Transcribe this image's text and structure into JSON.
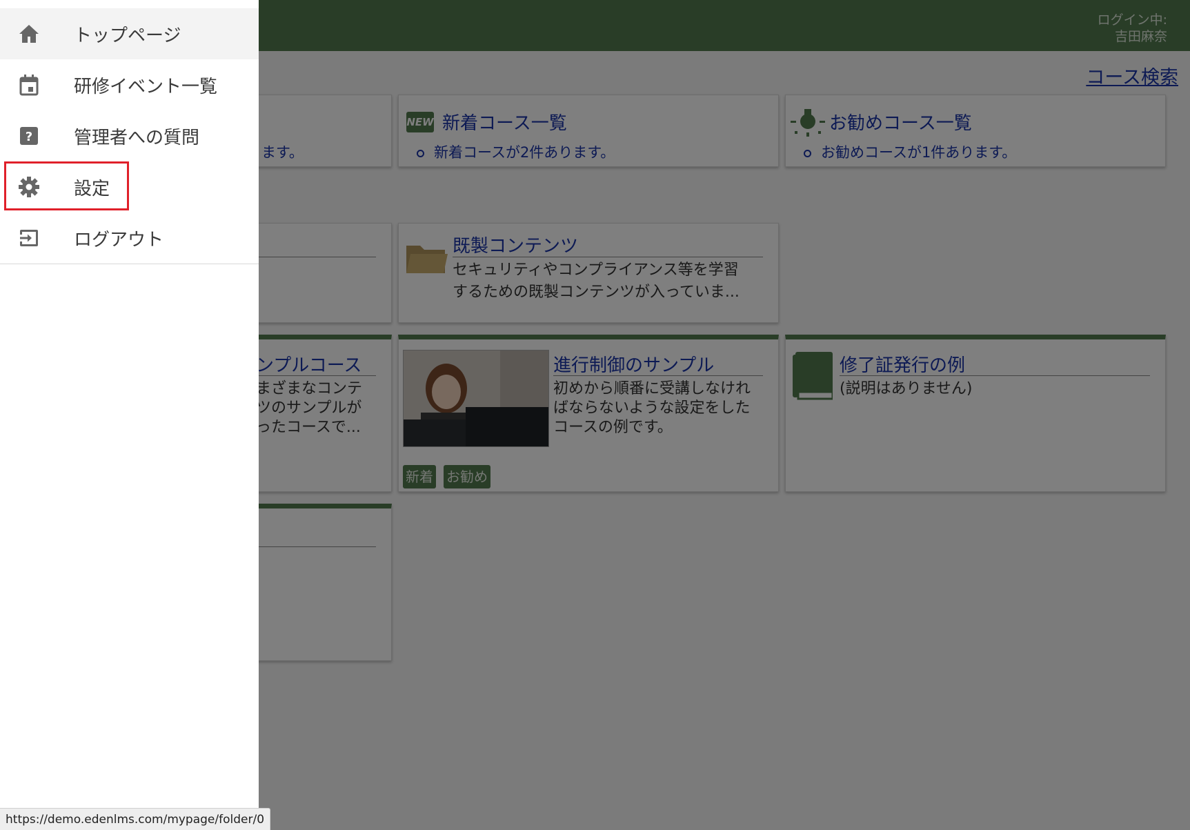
{
  "header": {
    "login_label": "ログイン中:",
    "login_user": "吉田麻奈",
    "course_search": "コース検索"
  },
  "summary_cards": [
    {
      "bullet": "ます。"
    },
    {
      "badge": "NEW",
      "title": "新着コース一覧",
      "bullet": "新着コースが2件あります。"
    },
    {
      "title": "お勧めコース一覧",
      "bullet": "お勧めコースが1件あります。"
    }
  ],
  "folder_card": {
    "title": "既製コンテンツ",
    "desc_line1": "セキュリティやコンプライアンス等を学習",
    "desc_line2": "するための既製コンテンツが入っていま..."
  },
  "course_cards": [
    {
      "title": "ンプルコース",
      "desc_line1": "まざまなコンテ",
      "desc_line2": "ツのサンプルが",
      "desc_line3": "ったコースで..."
    },
    {
      "title": "進行制御のサンプル",
      "desc_line1": "初めから順番に受講しなけれ",
      "desc_line2": "ばならないような設定をした",
      "desc_line3": "コースの例です。",
      "tags": [
        "新着",
        "お勧め"
      ]
    },
    {
      "title": "修了証発行の例",
      "desc_line1": "(説明はありません)"
    }
  ],
  "drawer": {
    "items": [
      {
        "label": "トップページ",
        "icon": "home-icon"
      },
      {
        "label": "研修イベント一覧",
        "icon": "calendar-icon"
      },
      {
        "label": "管理者への質問",
        "icon": "help-icon"
      },
      {
        "label": "設定",
        "icon": "gear-icon"
      },
      {
        "label": "ログアウト",
        "icon": "logout-icon"
      }
    ]
  },
  "status_bar": {
    "url": "https://demo.edenlms.com/mypage/folder/0"
  },
  "colors": {
    "header_green": "#527a4e",
    "link_blue": "#1a35a8",
    "highlight_red": "#e0202a"
  }
}
